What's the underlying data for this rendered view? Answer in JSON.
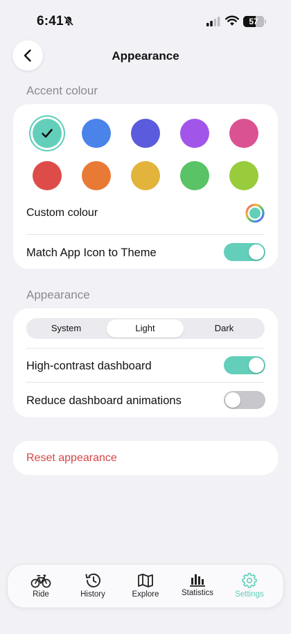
{
  "status_bar": {
    "time": "6:41",
    "battery": "57"
  },
  "nav": {
    "title": "Appearance"
  },
  "accent": {
    "header": "Accent colour",
    "swatches": [
      {
        "color": "#63CFBA",
        "selected": true
      },
      {
        "color": "#4A83EA",
        "selected": false
      },
      {
        "color": "#5B5BDD",
        "selected": false
      },
      {
        "color": "#A256E9",
        "selected": false
      },
      {
        "color": "#DB5292",
        "selected": false
      },
      {
        "color": "#DD4C48",
        "selected": false
      },
      {
        "color": "#E87A35",
        "selected": false
      },
      {
        "color": "#E2B43C",
        "selected": false
      },
      {
        "color": "#5AC366",
        "selected": false
      },
      {
        "color": "#98CC3C",
        "selected": false
      }
    ],
    "custom_label": "Custom colour",
    "match_icon_label": "Match App Icon to Theme",
    "match_icon_on": true
  },
  "appearance": {
    "header": "Appearance",
    "segments": [
      "System",
      "Light",
      "Dark"
    ],
    "selected_segment": "Light",
    "high_contrast_label": "High-contrast dashboard",
    "high_contrast_on": true,
    "reduce_animations_label": "Reduce dashboard animations",
    "reduce_animations_on": false
  },
  "reset": {
    "label": "Reset appearance"
  },
  "tabs": [
    {
      "label": "Ride",
      "icon": "bicycle-icon",
      "active": false
    },
    {
      "label": "History",
      "icon": "history-clock-icon",
      "active": false
    },
    {
      "label": "Explore",
      "icon": "map-icon",
      "active": false
    },
    {
      "label": "Statistics",
      "icon": "bar-chart-icon",
      "active": false
    },
    {
      "label": "Settings",
      "icon": "gear-icon",
      "active": true
    }
  ],
  "colors": {
    "accent": "#63CFBA",
    "destructive": "#D64545",
    "background": "#F1F1F6"
  }
}
